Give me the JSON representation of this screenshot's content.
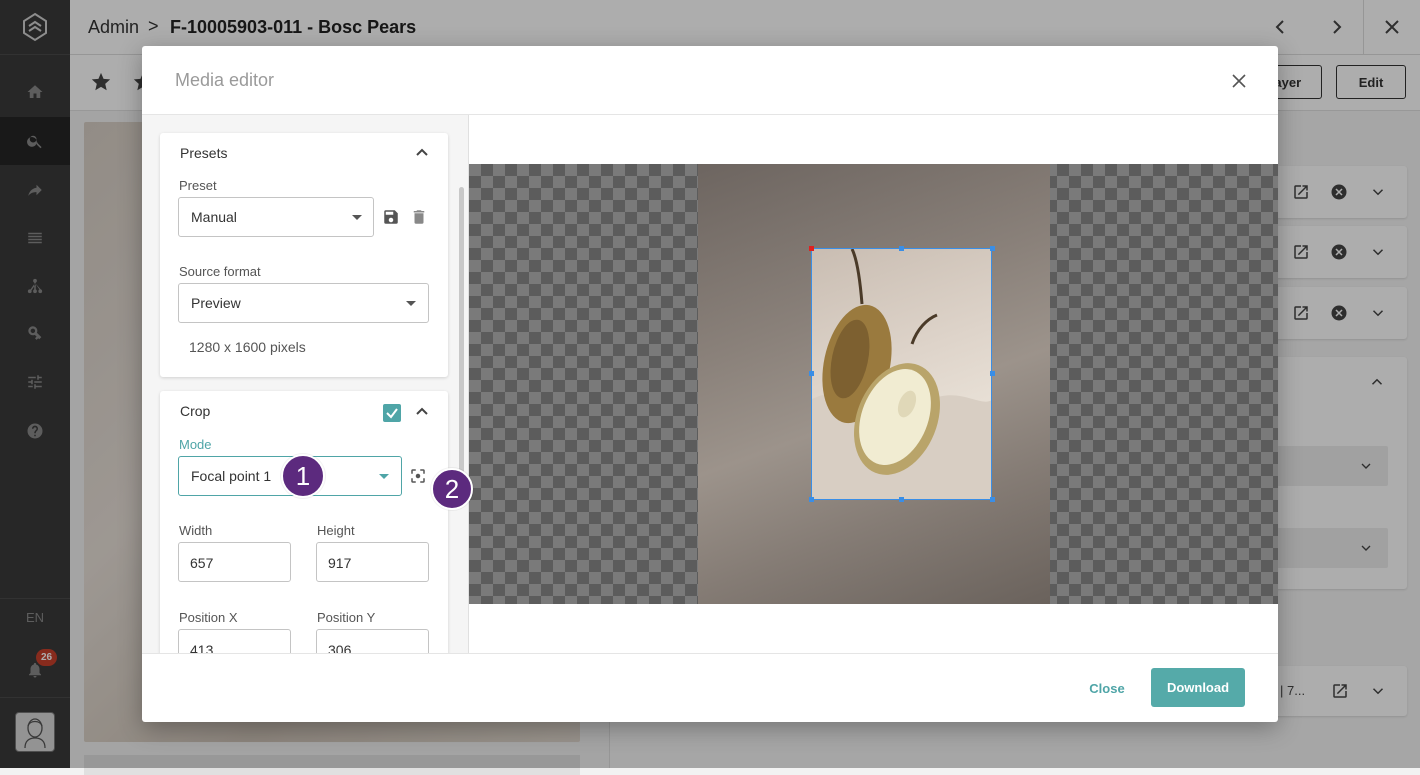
{
  "header": {
    "crumb_root": "Admin",
    "crumb_separator": ">",
    "crumb_current": "F-10005903-011 - Bosc Pears"
  },
  "toolbar": {
    "player_label": "layer",
    "edit_label": "Edit"
  },
  "right_panel": {
    "truncated_text": "| 7..."
  },
  "sidebar": {
    "language": "EN",
    "notifications_count": "26",
    "items": [
      "home-icon",
      "search-icon",
      "share-icon",
      "list-icon",
      "hierarchy-icon",
      "key-icon",
      "sliders-icon",
      "help-icon"
    ]
  },
  "modal": {
    "title": "Media editor",
    "presets": {
      "title": "Presets",
      "preset_label": "Preset",
      "preset_value": "Manual",
      "source_format_label": "Source format",
      "source_format_value": "Preview",
      "dimensions": "1280 x 1600 pixels"
    },
    "crop": {
      "title": "Crop",
      "enabled": true,
      "mode_label": "Mode",
      "mode_value": "Focal point 1",
      "width_label": "Width",
      "width_value": "657",
      "height_label": "Height",
      "height_value": "917",
      "position_x_label": "Position X",
      "position_x_value": "413",
      "position_y_label": "Position Y",
      "position_y_value": "306"
    },
    "step_badges": [
      "1",
      "2"
    ],
    "footer": {
      "close_label": "Close",
      "download_label": "Download"
    }
  },
  "colors": {
    "accent": "#55aaa9",
    "badge_purple": "#5c2a7e",
    "notification_red": "#c8402c",
    "crop_border": "#3a8ee6"
  }
}
